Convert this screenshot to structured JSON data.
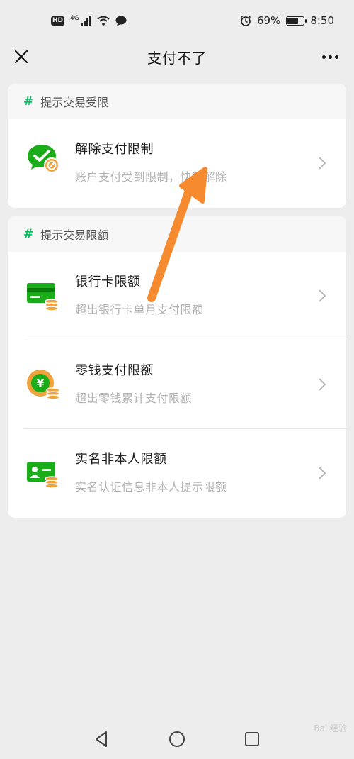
{
  "status_bar": {
    "hd": "HD",
    "net": "4G",
    "battery": "69%",
    "battery_level": 0.69,
    "time": "8:50"
  },
  "nav": {
    "title": "支付不了"
  },
  "section1": {
    "hash": "#",
    "header": "提示交易受限",
    "items": [
      {
        "title": "解除支付限制",
        "subtitle": "账户支付受到限制，快速解除",
        "icon": "wechat-pay-restricted-icon"
      }
    ]
  },
  "section2": {
    "hash": "#",
    "header": "提示交易限额",
    "items": [
      {
        "title": "银行卡限额",
        "subtitle": "超出银行卡单月支付限额",
        "icon": "bank-card-icon"
      },
      {
        "title": "零钱支付限额",
        "subtitle": "超出零钱累计支付限额",
        "icon": "change-coin-icon"
      },
      {
        "title": "实名非本人限额",
        "subtitle": "实名认证信息非本人提示限额",
        "icon": "id-card-icon"
      }
    ]
  },
  "watermark": "Bai 经验",
  "colors": {
    "accent": "#07c160",
    "icon_green": "#1aad19",
    "coin_orange": "#f0a23b",
    "arrow": "#f58b2e"
  }
}
